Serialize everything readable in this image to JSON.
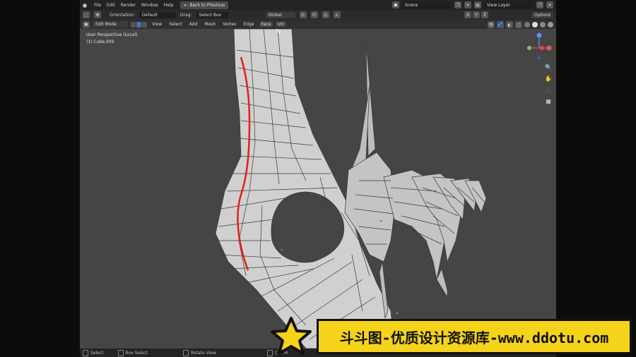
{
  "menu": [
    "File",
    "Edit",
    "Render",
    "Window",
    "Help"
  ],
  "back_label": "Back to Previous",
  "scene": "Scene",
  "view_layer": "View Layer",
  "toolhdr": {
    "orientation_label": "Orientation:",
    "orientation_value": "Default",
    "drag_label": "Drag:",
    "drag_value": "Select Box",
    "transform_value": "Global",
    "options_label": "Options"
  },
  "vphdr": {
    "mode": "Edit Mode",
    "menus": [
      "View",
      "Select",
      "Add",
      "Mesh",
      "Vertex",
      "Edge",
      "Face",
      "UV"
    ]
  },
  "viewport": {
    "perspective": "User Perspective (Local)",
    "object": "(1) Cube.009"
  },
  "statusbar": [
    "Select",
    "Box Select",
    "Rotate View",
    "Call M"
  ],
  "banner_text": "斗斗图-优质设计资源库-www.ddotu.com",
  "colors": {
    "seam": "#e0201b",
    "accent": "#4772b3",
    "banner": "#f5d31a"
  }
}
